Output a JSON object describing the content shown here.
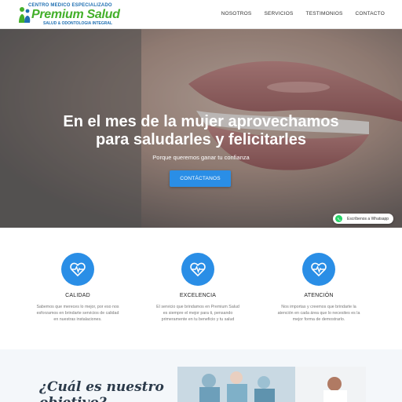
{
  "header": {
    "logo": {
      "top_text": "CENTRO MEDICO ESPECIALIZADO",
      "main_text": "Premium Salud",
      "sub_text": "SALUD & ODONTOLOGIA INTEGRAL"
    },
    "nav": [
      "NOSOTROS",
      "SERVICIOS",
      "TESTIMONIOS",
      "CONTACTO"
    ]
  },
  "hero": {
    "title_line1": "En el mes de la mujer aprovechamos",
    "title_line2": "para saludarles y felicitarles",
    "subtitle": "Porque queremos ganar tu confianza",
    "button_label": "CONTÁCTANOS"
  },
  "whatsapp": {
    "label": "Escríbenos a Whatsapp",
    "icon": "whatsapp-icon"
  },
  "features": [
    {
      "icon": "heart-pulse-icon",
      "title": "CALIDAD",
      "text": "Sabemos que mereces lo mejor, por eso nos esforzamos en brindarte servicios de calidad en nuestras instalaciones."
    },
    {
      "icon": "heart-pulse-icon",
      "title": "EXCELENCIA",
      "text": "El servicio que brindamos en Premium Salud es siempre el mejor para ti, pensando primeramente en tu beneficio y tu salud"
    },
    {
      "icon": "heart-pulse-icon",
      "title": "ATENCIÓN",
      "text": "Nos importas y creemos que brindarte la atención en cada área que lo necesites es la mejor forma de demostrarlo."
    }
  ],
  "objective": {
    "title_line1": "¿Cuál es nuestro",
    "title_line2": "objetivo?"
  },
  "colors": {
    "accent": "#2a8ee6",
    "brand_green": "#43b02a",
    "brand_blue": "#1f6fb2",
    "whatsapp": "#25d366"
  }
}
